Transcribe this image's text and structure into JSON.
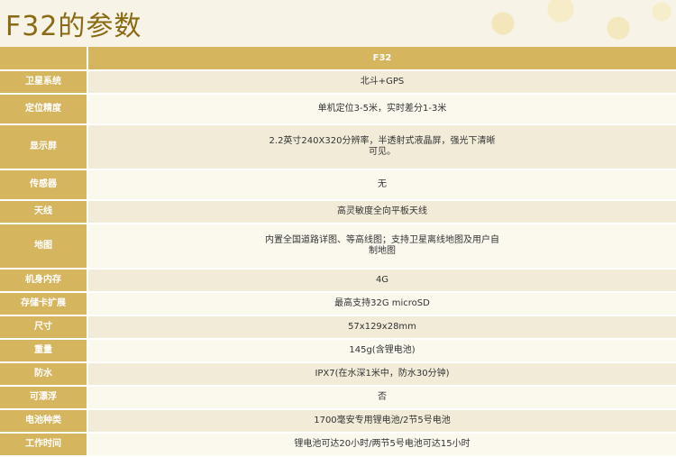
{
  "title": "F32的参数",
  "header": {
    "key": "",
    "model": "F32"
  },
  "rows": [
    {
      "key": "卫星系统",
      "value": "北斗+GPS"
    },
    {
      "key": "定位精度",
      "value": "单机定位3-5米，实时差分1-3米"
    },
    {
      "key": "显示屏",
      "value": "2.2英寸240X320分辨率，半透射式液晶屏，强光下清晰可见。"
    },
    {
      "key": "传感器",
      "value": "无"
    },
    {
      "key": "天线",
      "value": "高灵敏度全向平板天线"
    },
    {
      "key": "地图",
      "value": "内置全国道路详图、等高线图；支持卫星离线地图及用户自制地图"
    },
    {
      "key": "机身内存",
      "value": "4G"
    },
    {
      "key": "存储卡扩展",
      "value": "最高支持32G microSD"
    },
    {
      "key": "尺寸",
      "value": "57x129x28mm"
    },
    {
      "key": "重量",
      "value": "145g(含锂电池)"
    },
    {
      "key": "防水",
      "value": "IPX7(在水深1米中，防水30分钟)"
    },
    {
      "key": "可漂浮",
      "value": "否"
    },
    {
      "key": "电池种类",
      "value": "1700毫安专用锂电池/2节5号电池"
    },
    {
      "key": "工作时间",
      "value": "锂电池可达20小时/两节5号电池可达15小时"
    }
  ]
}
